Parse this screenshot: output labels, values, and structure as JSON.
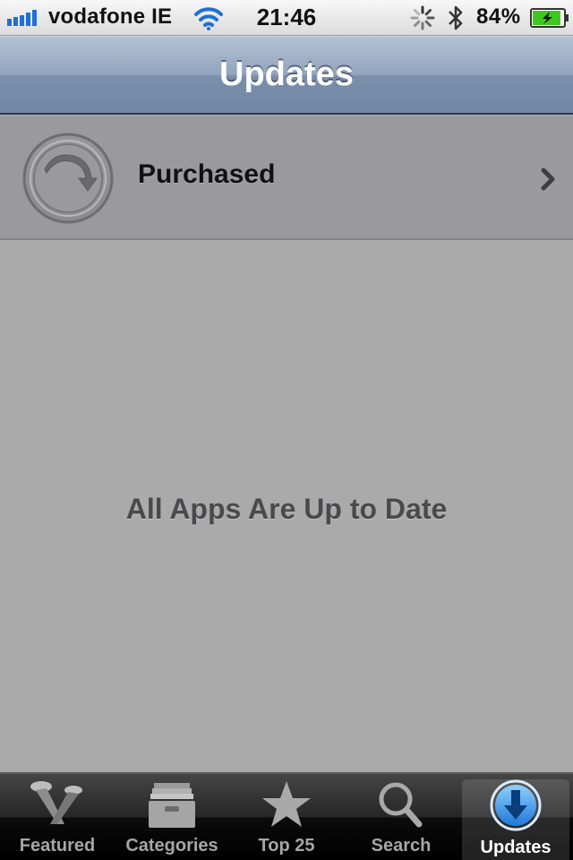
{
  "status_bar": {
    "carrier": "vodafone IE",
    "time": "21:46",
    "battery_percent": "84%",
    "signal_bars": 5,
    "battery_level": 0.84,
    "battery_color": "#3ec81f",
    "wifi_color": "#1f6fd6"
  },
  "nav": {
    "title": "Updates"
  },
  "purchased_row": {
    "label": "Purchased",
    "icon": "download-arrow-icon"
  },
  "empty_message": "All Apps Are Up to Date",
  "tabs": [
    {
      "label": "Featured",
      "icon": "featured-spotlight-icon",
      "active": false
    },
    {
      "label": "Categories",
      "icon": "categories-box-icon",
      "active": false
    },
    {
      "label": "Top 25",
      "icon": "star-icon",
      "active": false
    },
    {
      "label": "Search",
      "icon": "search-icon",
      "active": false
    },
    {
      "label": "Updates",
      "icon": "updates-download-icon",
      "active": true
    }
  ],
  "colors": {
    "nav_gradient_top": "#b4c2d4",
    "nav_gradient_bottom": "#6f86a5",
    "background": "#aaaaab",
    "row_background": "#9a999c",
    "active_tab_icon": "#2f93e8"
  }
}
